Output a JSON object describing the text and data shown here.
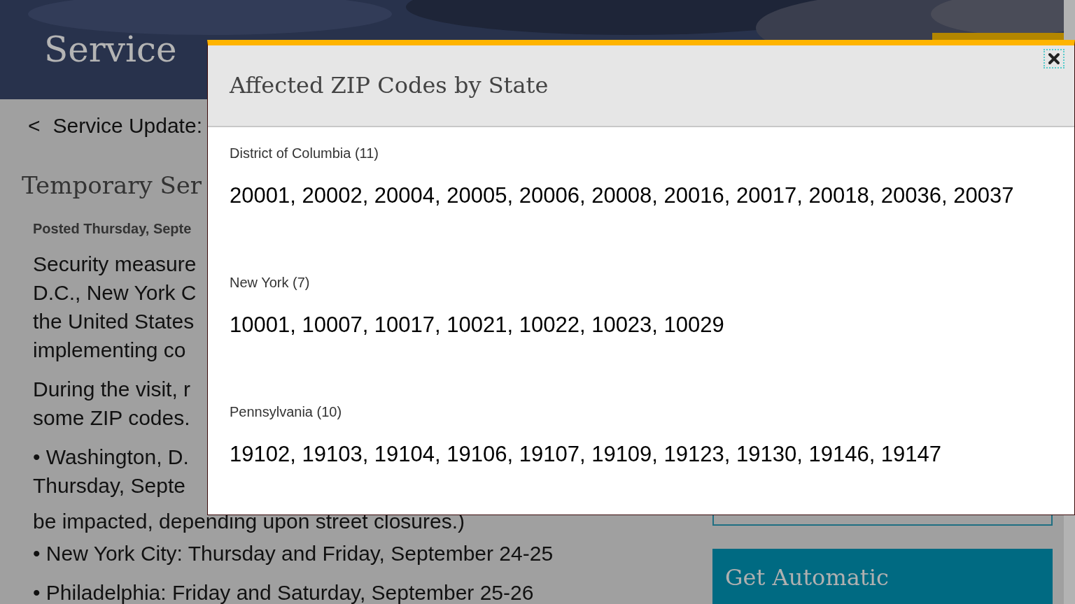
{
  "page": {
    "header_title": "Service",
    "breadcrumb": {
      "arrow": "<",
      "label": "Service Update:"
    },
    "article": {
      "heading": "Temporary Ser",
      "posted": "Posted Thursday, Septe",
      "paragraphs": [
        {
          "lines": [
            "Security measure",
            "D.C., New York C",
            "the United States",
            "implementing co"
          ]
        },
        {
          "lines": [
            "During the visit, r",
            "some ZIP codes."
          ]
        },
        {
          "lines": [
            "• Washington, D.",
            "Thursday, Septe",
            "be impacted, depending upon street closures.)"
          ]
        },
        {
          "lines": [
            "• New York City: Thursday and Friday, September 24-25"
          ]
        },
        {
          "lines": [
            "• Philadelphia: Friday and Saturday, September 25-26"
          ]
        }
      ]
    },
    "sidebar_card_title": "Get Automatic"
  },
  "modal": {
    "title": "Affected ZIP Codes by State",
    "states": [
      {
        "label": "District of Columbia (11)",
        "zips": "20001, 20002, 20004, 20005, 20006, 20008, 20016, 20017, 20018, 20036, 20037"
      },
      {
        "label": "New York (7)",
        "zips": "10001, 10007, 10017, 10021, 10022, 10023, 10029"
      },
      {
        "label": "Pennsylvania (10)",
        "zips": "19102, 19103, 19104, 19106, 19107, 19109, 19123, 19130, 19146, 19147"
      }
    ]
  }
}
